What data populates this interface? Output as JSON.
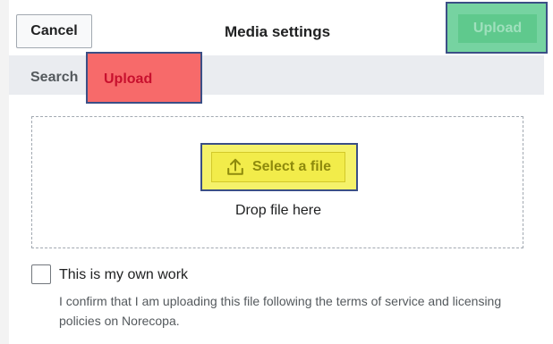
{
  "header": {
    "cancel_label": "Cancel",
    "title": "Media settings",
    "upload_label": "Upload"
  },
  "tabs": [
    {
      "label": "Search",
      "active": false
    },
    {
      "label": "Upload",
      "active": true
    }
  ],
  "dropzone": {
    "select_label": "Select a file",
    "select_icon": "upload-icon",
    "drop_text": "Drop file here"
  },
  "own_work": {
    "checked": false,
    "label": "This is my own work",
    "help": "I confirm that I am uploading this file following the terms of service and licensing policies on Norecopa."
  },
  "colors": {
    "primary_highlight": "#76d3a1",
    "tab_highlight": "#f76a6a",
    "select_highlight": "#f5f26a",
    "highlight_border": "#3b4f86"
  }
}
